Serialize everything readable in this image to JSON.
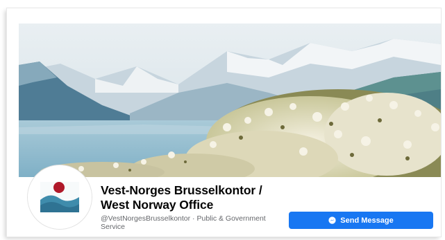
{
  "page": {
    "name_line1": "Vest-Norges Brusselkontor /",
    "name_line2": "West Norway Office",
    "username": "@VestNorgesBrusselkontor",
    "category": "Public & Government Service",
    "separator": " · "
  },
  "actions": {
    "send_message_label": "Send Message"
  },
  "colors": {
    "button": "#1877f2",
    "logo_dot": "#b0192a",
    "logo_waves": "#3f8cac"
  },
  "icons": {
    "messenger": "messenger-icon"
  }
}
